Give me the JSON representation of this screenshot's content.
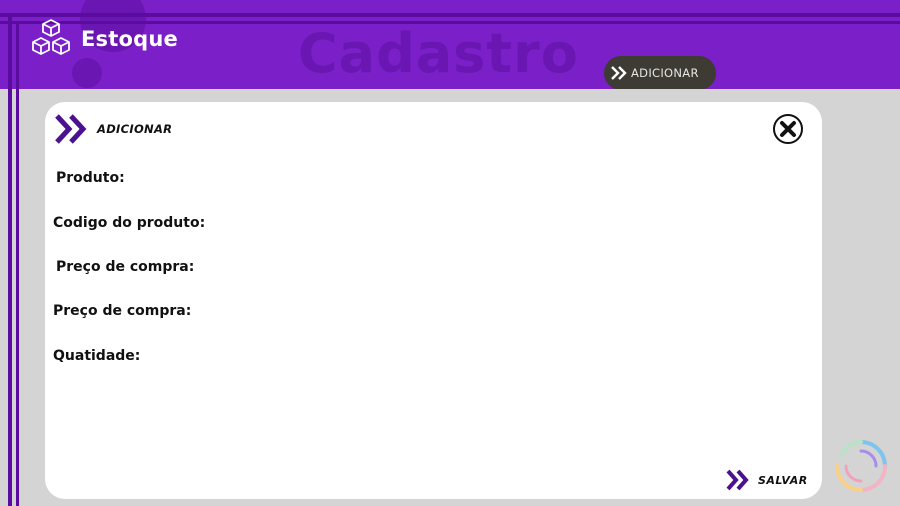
{
  "app": {
    "logo_text": "Estoque"
  },
  "header": {
    "page_title": "Cadastro",
    "add_button_label": "ADICIONAR"
  },
  "modal": {
    "title": "ADICIONAR",
    "fields": [
      {
        "label": "Produto:"
      },
      {
        "label": "Codigo do produto:"
      },
      {
        "label": "Preço de compra:"
      },
      {
        "label": "Preço de compra:"
      },
      {
        "label": "Quatidade:"
      }
    ],
    "save_label": "SALVAR"
  },
  "colors": {
    "header_purple": "#7b1fc9",
    "accent_purple": "#5a17a8",
    "header_button_bg": "#3d3b33",
    "page_bg": "#d4d4d4"
  },
  "icons": {
    "logo": "boxes-icon",
    "chevron": "double-chevron-right-icon",
    "close": "close-circle-icon",
    "loader": "loading-spinner-icon"
  }
}
